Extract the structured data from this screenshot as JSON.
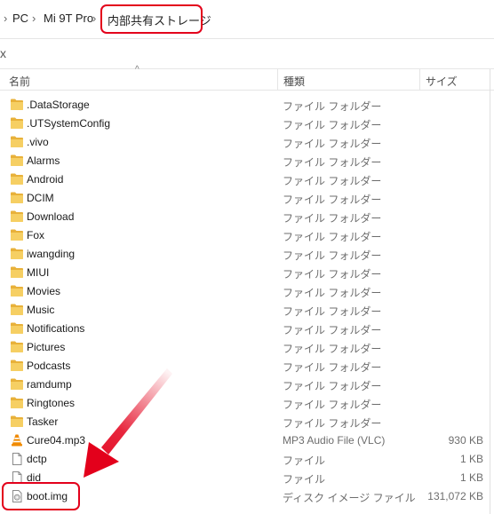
{
  "breadcrumb": {
    "items": [
      "PC",
      "Mi 9T Pro",
      "内部共有ストレージ"
    ],
    "separator": "›"
  },
  "toolbar": {
    "close_glyph": "x"
  },
  "columns": {
    "name": "名前",
    "type": "種類",
    "size": "サイズ"
  },
  "files": [
    {
      "name": ".DataStorage",
      "type": "ファイル フォルダー",
      "size": "",
      "icon": "folder-icon"
    },
    {
      "name": ".UTSystemConfig",
      "type": "ファイル フォルダー",
      "size": "",
      "icon": "folder-icon"
    },
    {
      "name": ".vivo",
      "type": "ファイル フォルダー",
      "size": "",
      "icon": "folder-icon"
    },
    {
      "name": "Alarms",
      "type": "ファイル フォルダー",
      "size": "",
      "icon": "folder-icon"
    },
    {
      "name": "Android",
      "type": "ファイル フォルダー",
      "size": "",
      "icon": "folder-icon"
    },
    {
      "name": "DCIM",
      "type": "ファイル フォルダー",
      "size": "",
      "icon": "folder-icon"
    },
    {
      "name": "Download",
      "type": "ファイル フォルダー",
      "size": "",
      "icon": "folder-icon"
    },
    {
      "name": "Fox",
      "type": "ファイル フォルダー",
      "size": "",
      "icon": "folder-icon"
    },
    {
      "name": "iwangding",
      "type": "ファイル フォルダー",
      "size": "",
      "icon": "folder-icon"
    },
    {
      "name": "MIUI",
      "type": "ファイル フォルダー",
      "size": "",
      "icon": "folder-icon"
    },
    {
      "name": "Movies",
      "type": "ファイル フォルダー",
      "size": "",
      "icon": "folder-icon"
    },
    {
      "name": "Music",
      "type": "ファイル フォルダー",
      "size": "",
      "icon": "folder-icon"
    },
    {
      "name": "Notifications",
      "type": "ファイル フォルダー",
      "size": "",
      "icon": "folder-icon"
    },
    {
      "name": "Pictures",
      "type": "ファイル フォルダー",
      "size": "",
      "icon": "folder-icon"
    },
    {
      "name": "Podcasts",
      "type": "ファイル フォルダー",
      "size": "",
      "icon": "folder-icon"
    },
    {
      "name": "ramdump",
      "type": "ファイル フォルダー",
      "size": "",
      "icon": "folder-icon"
    },
    {
      "name": "Ringtones",
      "type": "ファイル フォルダー",
      "size": "",
      "icon": "folder-icon"
    },
    {
      "name": "Tasker",
      "type": "ファイル フォルダー",
      "size": "",
      "icon": "folder-icon"
    },
    {
      "name": "Cure04.mp3",
      "type": "MP3 Audio File (VLC)",
      "size": "930 KB",
      "icon": "vlc-cone-icon"
    },
    {
      "name": "dctp",
      "type": "ファイル",
      "size": "1 KB",
      "icon": "file-icon"
    },
    {
      "name": "did",
      "type": "ファイル",
      "size": "1 KB",
      "icon": "file-icon"
    },
    {
      "name": "boot.img",
      "type": "ディスク イメージ ファイル",
      "size": "131,072 KB",
      "icon": "disk-image-icon"
    }
  ],
  "colors": {
    "highlight": "#e3001b",
    "folder": "#f2c04a",
    "arrow": "#e3001b"
  }
}
